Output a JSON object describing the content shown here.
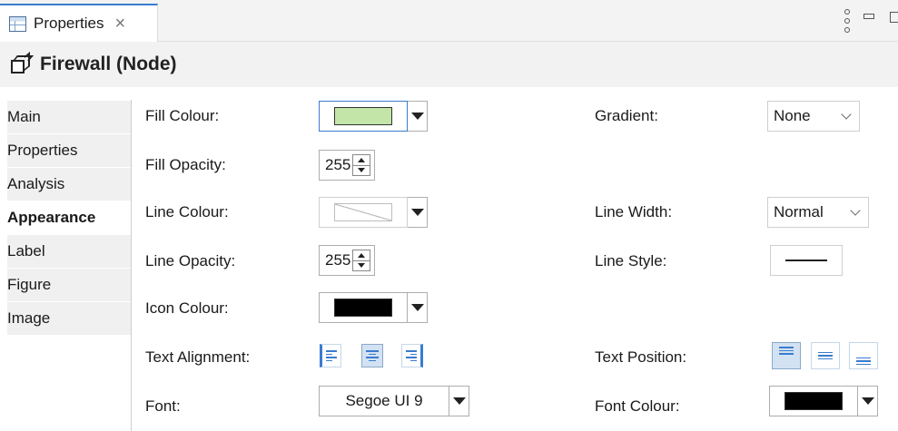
{
  "tab": {
    "label": "Properties",
    "close": "×"
  },
  "title": "Firewall (Node)",
  "nav": {
    "items": [
      {
        "label": "Main"
      },
      {
        "label": "Properties"
      },
      {
        "label": "Analysis"
      },
      {
        "label": "Appearance",
        "selected": true
      },
      {
        "label": "Label"
      },
      {
        "label": "Figure"
      },
      {
        "label": "Image"
      }
    ]
  },
  "form": {
    "fill_colour": {
      "label": "Fill Colour:",
      "value": "#c3e6a8"
    },
    "fill_opacity": {
      "label": "Fill Opacity:",
      "value": "255"
    },
    "line_colour": {
      "label": "Line Colour:",
      "value": "none"
    },
    "line_opacity": {
      "label": "Line Opacity:",
      "value": "255"
    },
    "icon_colour": {
      "label": "Icon Colour:",
      "value": "#000000"
    },
    "text_alignment": {
      "label": "Text Alignment:",
      "selected": "center"
    },
    "font": {
      "label": "Font:",
      "value": "Segoe UI 9"
    },
    "gradient": {
      "label": "Gradient:",
      "value": "None"
    },
    "line_width": {
      "label": "Line Width:",
      "value": "Normal"
    },
    "line_style": {
      "label": "Line Style:",
      "value": "solid"
    },
    "text_position": {
      "label": "Text Position:",
      "selected": "top"
    },
    "font_colour": {
      "label": "Font Colour:",
      "value": "#000000"
    }
  },
  "colors": {
    "accent": "#3a7ccf",
    "fill_swatch": "#c3e6a8",
    "black_swatch": "#000000"
  }
}
